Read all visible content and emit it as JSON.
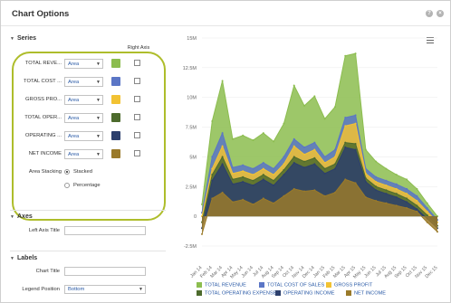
{
  "dialog": {
    "title": "Chart Options",
    "help_icon": "question-icon",
    "close_icon": "close-icon"
  },
  "series_section": {
    "title": "Series",
    "right_axis_header": "Right Axis",
    "rows": [
      {
        "label": "TOTAL REVE...",
        "type": "Area",
        "color": "#8cbd4f"
      },
      {
        "label": "TOTAL COST ...",
        "type": "Area",
        "color": "#5b76c6"
      },
      {
        "label": "GROSS PRO...",
        "type": "Area",
        "color": "#f2c233"
      },
      {
        "label": "TOTAL OPER...",
        "type": "Area",
        "color": "#4d6b2d"
      },
      {
        "label": "OPERATING ...",
        "type": "Area",
        "color": "#2c3f6c"
      },
      {
        "label": "NET INCOME",
        "type": "Area",
        "color": "#9a7a2a"
      }
    ],
    "stacking_label": "Area Stacking",
    "stacking_options": [
      "Stacked",
      "Percentage"
    ],
    "stacking_selected": "Stacked"
  },
  "axes_section": {
    "title": "Axes",
    "left_axis_title_label": "Left Axis Title",
    "left_axis_title_value": ""
  },
  "labels_section": {
    "title": "Labels",
    "chart_title_label": "Chart Title",
    "chart_title_value": "",
    "legend_position_label": "Legend Position",
    "legend_position_value": "Bottom"
  },
  "chart_data": {
    "type": "area",
    "x": [
      "Jan 14",
      "Feb 14",
      "Mar 14",
      "Apr 14",
      "May 14",
      "Jun 14",
      "Jul 14",
      "Aug 14",
      "Sep 14",
      "Oct 14",
      "Nov 14",
      "Dec 14",
      "Jan 15",
      "Feb 15",
      "Mar 15",
      "Apr 15",
      "May 15",
      "Jun 15",
      "Jul 15",
      "Aug 15",
      "Sep 15",
      "Oct 15",
      "Nov 15",
      "Dec 15"
    ],
    "y_ticks": [
      "15M",
      "12.5M",
      "10M",
      "7.5M",
      "5M",
      "2.5M",
      "0",
      "-2.5M"
    ],
    "ylim": [
      -2500000,
      15000000
    ],
    "series": [
      {
        "name": "TOTAL REVENUE",
        "color": "#8cbd4f",
        "values": [
          1000000,
          8000000,
          11400000,
          6500000,
          6800000,
          6400000,
          7000000,
          6300000,
          7800000,
          11000000,
          9300000,
          10100000,
          8200000,
          9200000,
          13500000,
          13700000,
          5600000,
          4600000,
          4000000,
          3500000,
          3100000,
          2300000,
          1100000,
          0
        ]
      },
      {
        "name": "TOTAL COST OF SALES",
        "color": "#5b76c6",
        "values": [
          300000,
          5000000,
          7000000,
          4100000,
          4300000,
          4000000,
          4500000,
          4000000,
          5000000,
          6500000,
          5800000,
          6200000,
          5000000,
          5600000,
          8300000,
          8500000,
          4000000,
          3300000,
          3000000,
          2700000,
          2300000,
          1700000,
          700000,
          -300000
        ]
      },
      {
        "name": "GROSS PROFIT",
        "color": "#f2c233",
        "values": [
          0,
          4000000,
          5900000,
          3600000,
          3800000,
          3500000,
          4000000,
          3500000,
          4400000,
          5900000,
          5200000,
          5600000,
          4500000,
          5000000,
          7600000,
          7800000,
          3600000,
          2900000,
          2600000,
          2300000,
          1900000,
          1300000,
          400000,
          -500000
        ]
      },
      {
        "name": "TOTAL OPERATING EXPENSES",
        "color": "#4d6b2d",
        "values": [
          -500000,
          3500000,
          5000000,
          3100000,
          3300000,
          3000000,
          3500000,
          3000000,
          3900000,
          5000000,
          4600000,
          4900000,
          4000000,
          4400000,
          6200000,
          6100000,
          3200000,
          2500000,
          2200000,
          1900000,
          1500000,
          900000,
          100000,
          -800000
        ]
      },
      {
        "name": "OPERATING INCOME",
        "color": "#2c3f6c",
        "values": [
          -1000000,
          3000000,
          4400000,
          2700000,
          2900000,
          2600000,
          3100000,
          2600000,
          3500000,
          4500000,
          4100000,
          4400000,
          3600000,
          4000000,
          5800000,
          5600000,
          2900000,
          2200000,
          1900000,
          1600000,
          1200000,
          600000,
          -200000,
          -1000000
        ]
      },
      {
        "name": "NET INCOME",
        "color": "#9a7a2a",
        "values": [
          -1500000,
          1500000,
          2000000,
          1200000,
          1400000,
          1000000,
          1500000,
          1100000,
          1700000,
          2300000,
          2100000,
          2200000,
          1700000,
          2000000,
          3100000,
          2800000,
          1600000,
          1300000,
          1100000,
          900000,
          700000,
          400000,
          -500000,
          -1300000
        ]
      }
    ]
  },
  "chart_menu_icon": "hamburger-menu-icon"
}
